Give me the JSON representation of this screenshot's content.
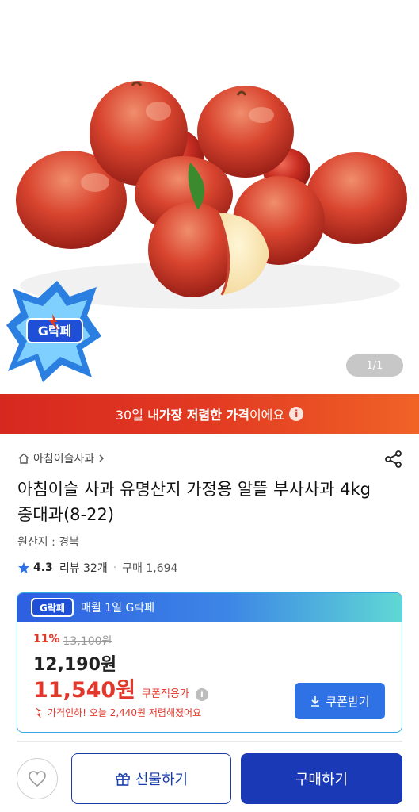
{
  "gallery": {
    "counter": "1/1",
    "badge_text": "G락페"
  },
  "promo": {
    "prefix": "30일 내 ",
    "highlight": "가장 저렴한 가격",
    "suffix": "이에요"
  },
  "breadcrumb": {
    "store": "아침이슬사과"
  },
  "product": {
    "title": "아침이슬 사과 유명산지 가정용 알뜰 부사사과 4kg 중대과(8-22)",
    "origin": "원산지 : 경북",
    "rating": "4.3",
    "review_label": "리뷰 32개",
    "purchase_label": "구매 1,694"
  },
  "coupon_card": {
    "header_text": "매월 1일 G락페",
    "discount_pct": "11%",
    "original_price": "13,100원",
    "price": "12,190원",
    "coupon_price": "11,540원",
    "coupon_price_label": "쿠폰적용가",
    "drop_text": "가격인하! 오늘 2,440원 저렴해졌어요",
    "coupon_button": "쿠폰받기"
  },
  "bottom_bar": {
    "gift_label": "선물하기",
    "buy_label": "구매하기"
  },
  "colors": {
    "accent_red": "#e2372b",
    "brand_blue": "#1939b7",
    "coupon_blue": "#2e72e6"
  }
}
